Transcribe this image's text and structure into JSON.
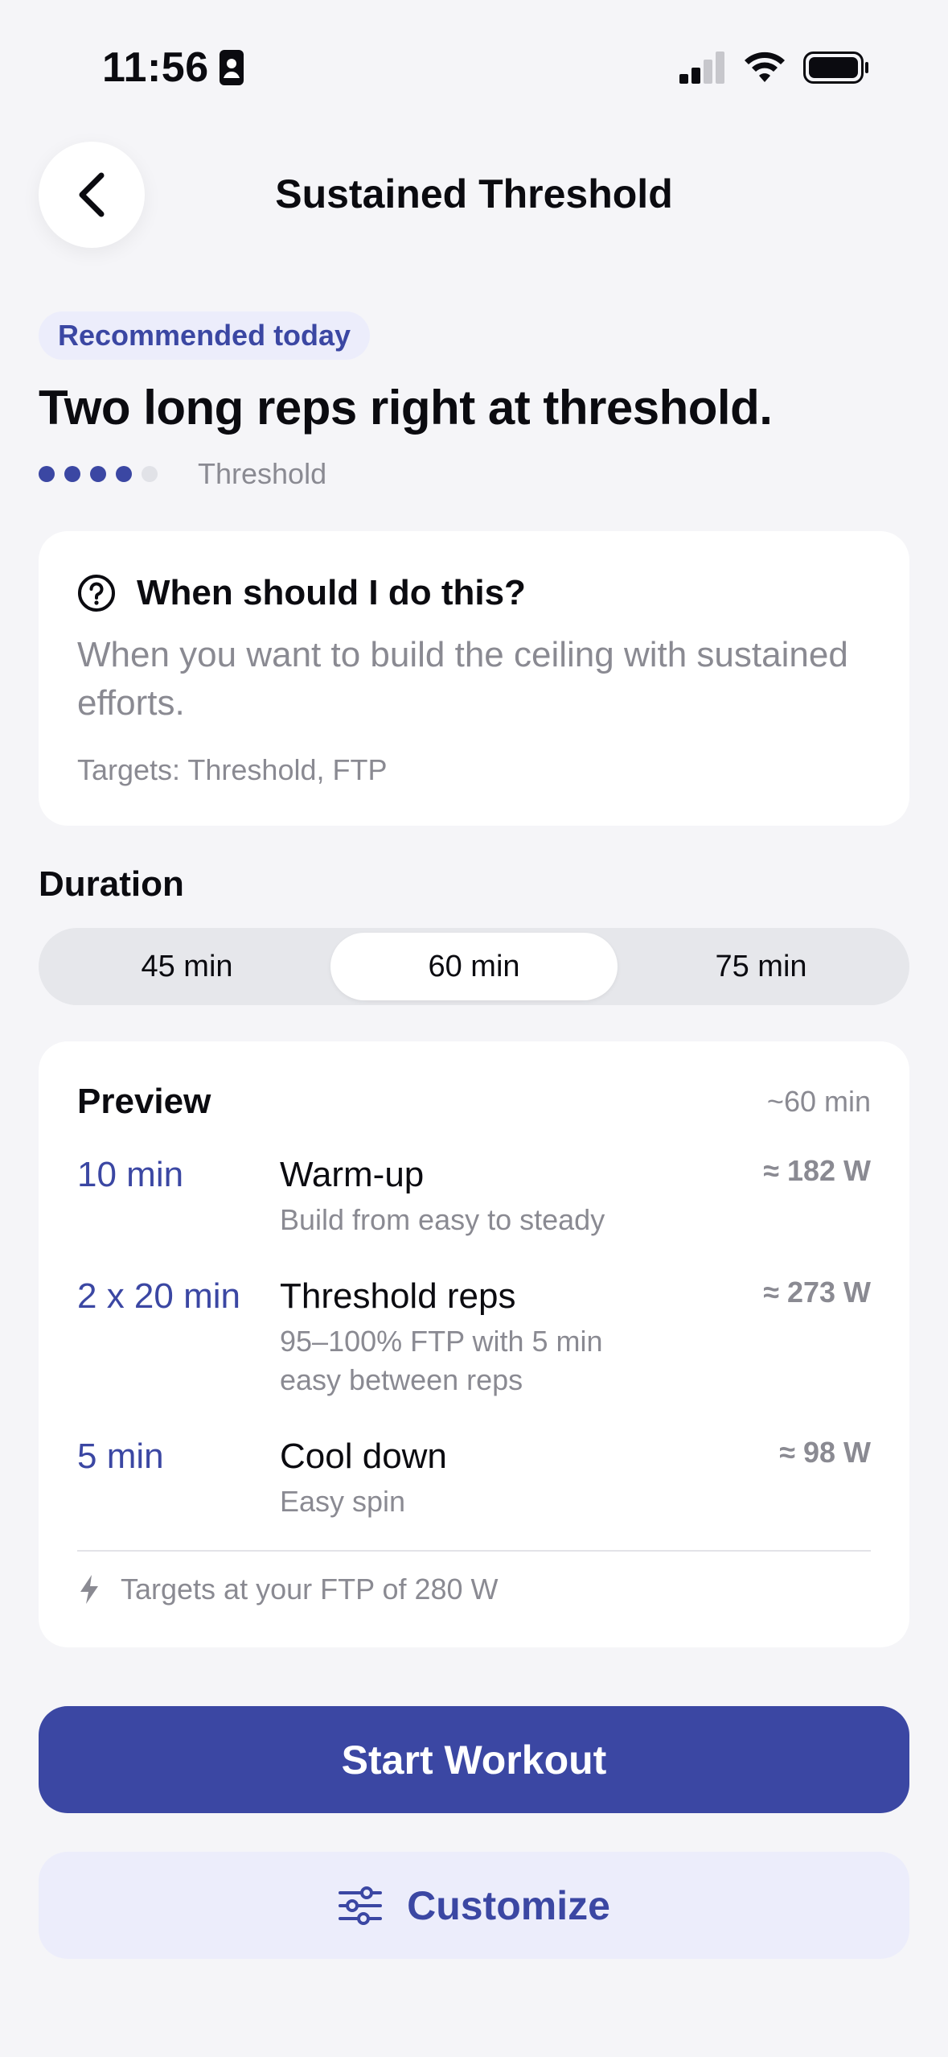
{
  "status_bar": {
    "time": "11:56"
  },
  "header": {
    "title": "Sustained Threshold",
    "back_icon": "chevron-left-icon"
  },
  "recommendation": {
    "badge": "Recommended today"
  },
  "headline": "Two long reps right at threshold.",
  "intensity": {
    "level": 4,
    "max": 5,
    "label": "Threshold"
  },
  "info": {
    "question": "When should I do this?",
    "body": "When you want to build the ceiling with sustained efforts.",
    "targets": "Targets: Threshold, FTP"
  },
  "duration": {
    "label": "Duration",
    "options": [
      "45 min",
      "60 min",
      "75 min"
    ],
    "selected": "60 min"
  },
  "preview": {
    "title": "Preview",
    "total": "~60 min",
    "steps": [
      {
        "duration": "10 min",
        "name": "Warm-up",
        "description": "Build from easy to steady",
        "watts": "≈ 182 W"
      },
      {
        "duration": "2 x 20 min",
        "name": "Threshold reps",
        "description": "95–100% FTP with 5 min easy between reps",
        "watts": "≈ 273 W"
      },
      {
        "duration": "5 min",
        "name": "Cool down",
        "description": "Easy spin",
        "watts": "≈ 98 W"
      }
    ],
    "footer": "Targets at your FTP of 280 W"
  },
  "actions": {
    "start": "Start Workout",
    "customize": "Customize"
  },
  "colors": {
    "accent": "#3B47A3",
    "accent_soft": "#ECEDFB",
    "muted": "#8A8A92",
    "background": "#F5F5F8"
  }
}
